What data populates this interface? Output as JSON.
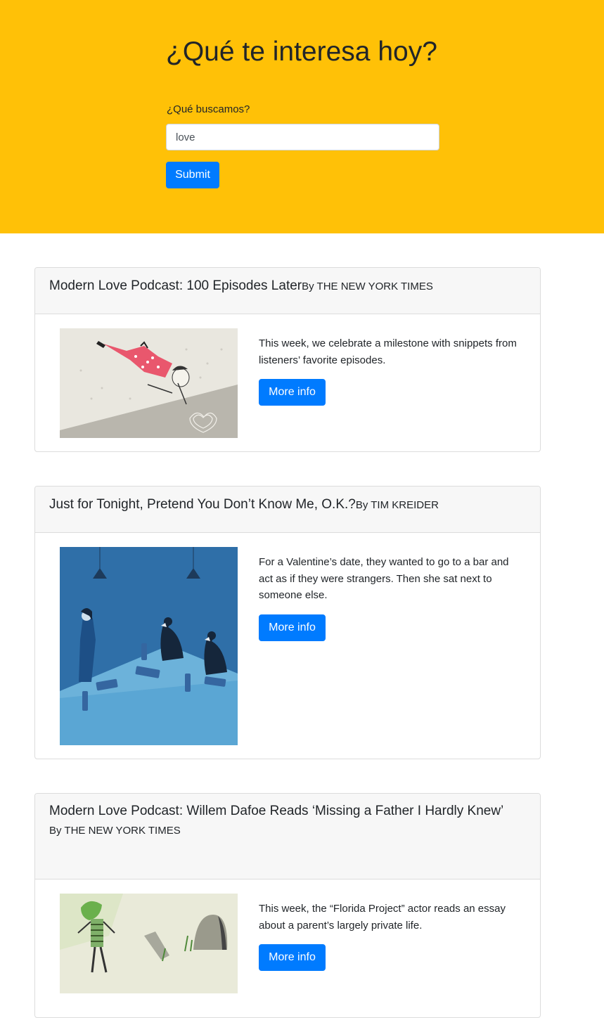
{
  "hero": {
    "title": "¿Qué te interesa hoy?",
    "field_label": "¿Qué buscamos?",
    "search_value": "love",
    "submit_label": "Submit",
    "background_color": "#ffc107"
  },
  "articles": [
    {
      "title": "Modern Love Podcast: 100 Episodes Later",
      "byline": "By THE NEW YORK TIMES",
      "description": "This week, we celebrate a milestone with snippets from listeners’ favorite episodes.",
      "button_label": "More info",
      "image_icon": "woman-falling-illustration"
    },
    {
      "title": "Just for Tonight, Pretend You Don’t Know Me, O.K.?",
      "byline": "By TIM KREIDER",
      "description": "For a Valentine’s date, they wanted to go to a bar and act as if they were strangers. Then she sat next to someone else.",
      "button_label": "More info",
      "image_icon": "woman-and-geese-at-table-illustration"
    },
    {
      "title": "Modern Love Podcast: Willem Dafoe Reads ‘Missing a Father I Hardly Knew’",
      "byline": "By THE NEW YORK TIMES",
      "description": "This week, the “Florida Project” actor reads an essay about a parent’s largely private life.",
      "button_label": "More info",
      "image_icon": "man-and-gravestone-illustration"
    }
  ],
  "colors": {
    "primary": "#007bff",
    "text": "#212529",
    "card_header_bg": "#f7f7f7"
  }
}
